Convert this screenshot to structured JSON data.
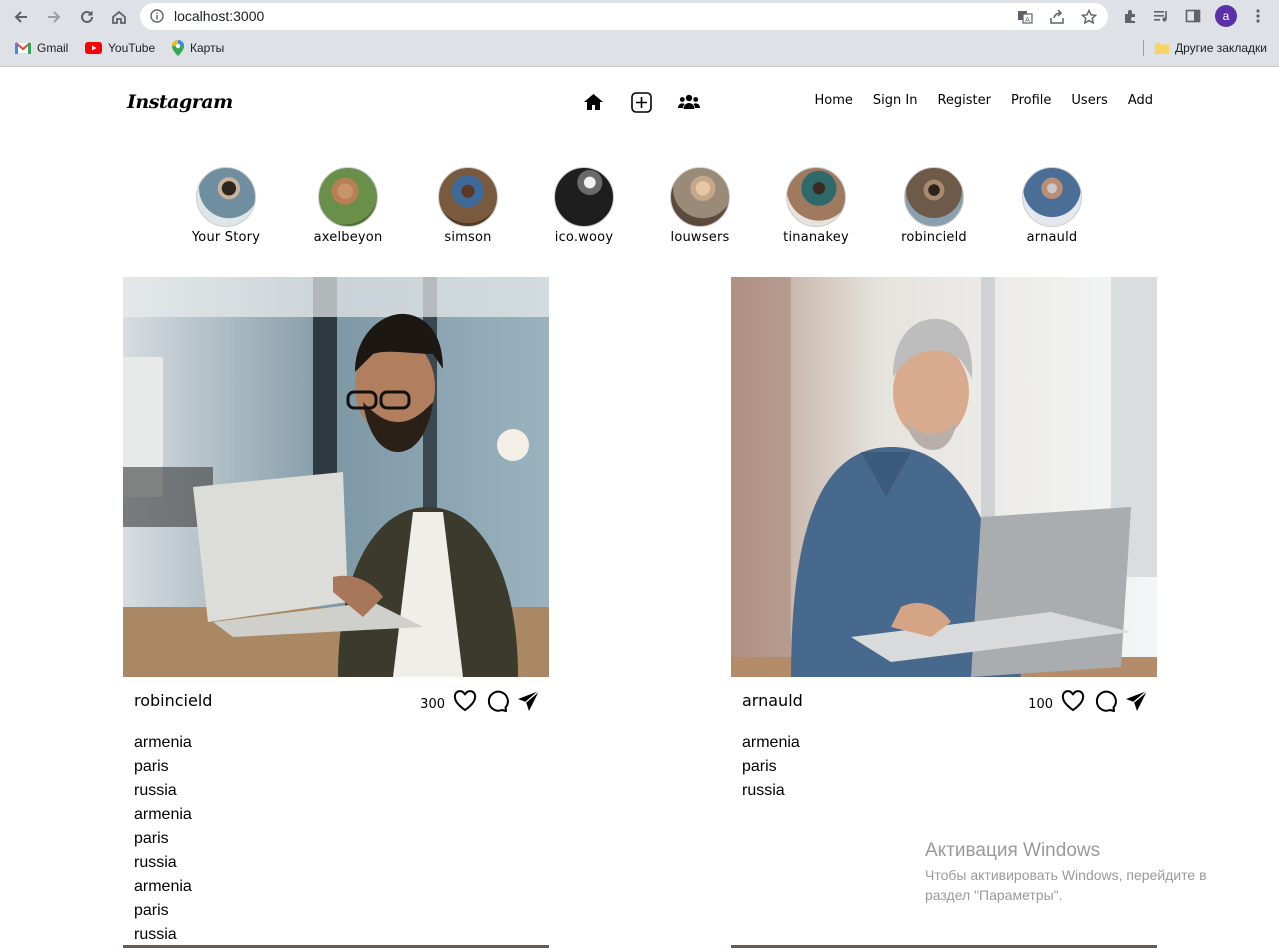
{
  "browser": {
    "url": "localhost:3000",
    "profile_initial": "a",
    "bookmarks": [
      {
        "label": "Gmail",
        "icon": "gmail-icon"
      },
      {
        "label": "YouTube",
        "icon": "youtube-icon"
      },
      {
        "label": "Карты",
        "icon": "maps-icon"
      }
    ],
    "other_bookmarks": "Другие закладки"
  },
  "app": {
    "logo": "Instagram",
    "header_icons": [
      "home-icon",
      "add-post-icon",
      "users-icon"
    ],
    "nav": [
      "Home",
      "Sign In",
      "Register",
      "Profile",
      "Users",
      "Add"
    ]
  },
  "stories": [
    {
      "name": "Your Story",
      "color": "#6f8fa0"
    },
    {
      "name": "axelbeyon",
      "color": "#6a8f4a"
    },
    {
      "name": "simson",
      "color": "#7a5a3e"
    },
    {
      "name": "ico.wooy",
      "color": "#1e1e1e"
    },
    {
      "name": "louwsers",
      "color": "#9a8a78"
    },
    {
      "name": "tinanakey",
      "color": "#a07a5e"
    },
    {
      "name": "robincield",
      "color": "#6d5a48"
    },
    {
      "name": "arnauld",
      "color": "#7e8a98"
    }
  ],
  "posts": [
    {
      "author": "robincield",
      "likes": "300",
      "tags": [
        "armenia",
        "paris",
        "russia",
        "armenia",
        "paris",
        "russia",
        "armenia",
        "paris",
        "russia"
      ]
    },
    {
      "author": "arnauld",
      "likes": "100",
      "tags": [
        "armenia",
        "paris",
        "russia"
      ]
    }
  ],
  "windows_watermark": {
    "title": "Активация Windows",
    "line1": "Чтобы активировать Windows, перейдите в",
    "line2": "раздел \"Параметры\"."
  }
}
